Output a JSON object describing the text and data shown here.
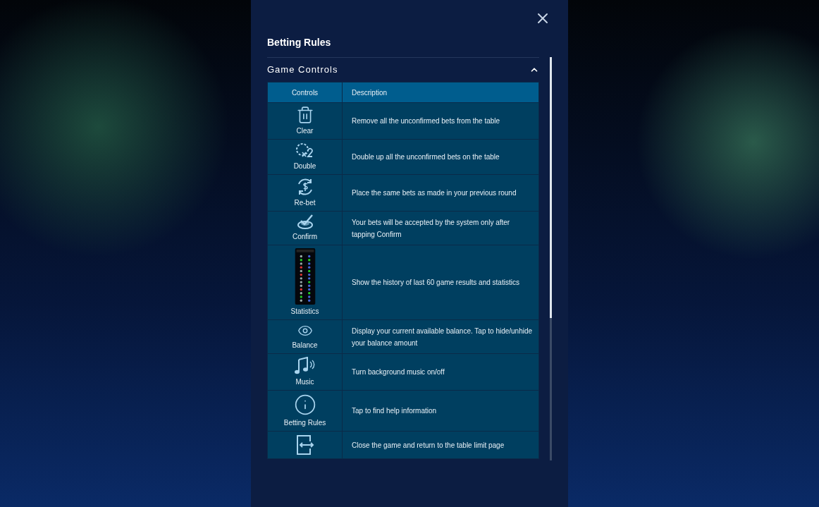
{
  "dialog": {
    "title": "Betting Rules"
  },
  "section": {
    "title": "Game Controls",
    "expanded": true
  },
  "table": {
    "columns": [
      "Controls",
      "Description"
    ],
    "rows": [
      {
        "label": "Clear",
        "description": "Remove all the unconfirmed bets from the table"
      },
      {
        "label": "Double",
        "description": "Double up all the unconfirmed bets on the table"
      },
      {
        "label": "Re-bet",
        "description": "Place the same bets as made in your previous round"
      },
      {
        "label": "Confirm",
        "description": "Your bets will be accepted by the system only after tapping Confirm"
      },
      {
        "label": "Statistics",
        "description": "Show the history of last 60 game results and statistics"
      },
      {
        "label": "Balance",
        "description": "Display your current available balance. Tap to hide/unhide your balance amount"
      },
      {
        "label": "Music",
        "description": "Turn background music on/off"
      },
      {
        "label": "Betting Rules",
        "description": "Tap to find help information"
      },
      {
        "description": "Close the game and return to the table limit page"
      }
    ]
  }
}
